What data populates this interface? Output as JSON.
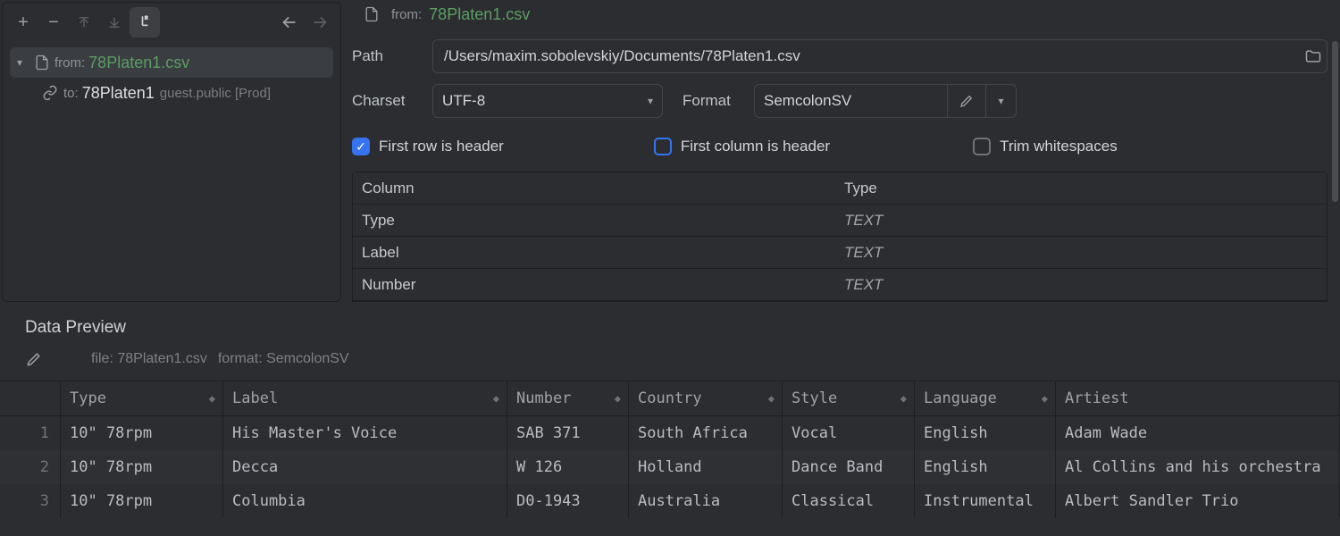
{
  "toolbar": {
    "add": "+",
    "remove": "−"
  },
  "tree": {
    "from_prefix": "from:",
    "from_file": "78Platen1.csv",
    "to_prefix": "to:",
    "to_name": "78Platen1",
    "to_loc": "guest.public [Prod]"
  },
  "crumb": {
    "prefix": "from:",
    "file": "78Platen1.csv"
  },
  "form": {
    "path_label": "Path",
    "path_value": "/Users/maxim.sobolevskiy/Documents/78Platen1.csv",
    "charset_label": "Charset",
    "charset_value": "UTF-8",
    "format_label": "Format",
    "format_value": "SemcolonSV"
  },
  "checks": {
    "first_row": "First row is header",
    "first_col": "First column is header",
    "trim": "Trim whitespaces"
  },
  "col_table": {
    "h1": "Column",
    "h2": "Type",
    "rows": [
      {
        "c": "Type",
        "t": "TEXT"
      },
      {
        "c": "Label",
        "t": "TEXT"
      },
      {
        "c": "Number",
        "t": "TEXT"
      }
    ]
  },
  "preview": {
    "title": "Data Preview",
    "meta_file": "file: 78Platen1.csv",
    "meta_format": "format: SemcolonSV",
    "headers": [
      "Type",
      "Label",
      "Number",
      "Country",
      "Style",
      "Language",
      "Artiest"
    ],
    "rows": [
      {
        "n": "1",
        "cells": [
          "10\" 78rpm",
          "His Master's Voice",
          "SAB 371",
          "South Africa",
          "Vocal",
          "English",
          "Adam Wade"
        ]
      },
      {
        "n": "2",
        "cells": [
          "10\" 78rpm",
          "Decca",
          "W 126",
          "Holland",
          "Dance Band",
          "English",
          "Al Collins and his orchestra"
        ]
      },
      {
        "n": "3",
        "cells": [
          "10\" 78rpm",
          "Columbia",
          "D0-1943",
          "Australia",
          "Classical",
          "Instrumental",
          "Albert Sandler Trio"
        ]
      }
    ]
  }
}
